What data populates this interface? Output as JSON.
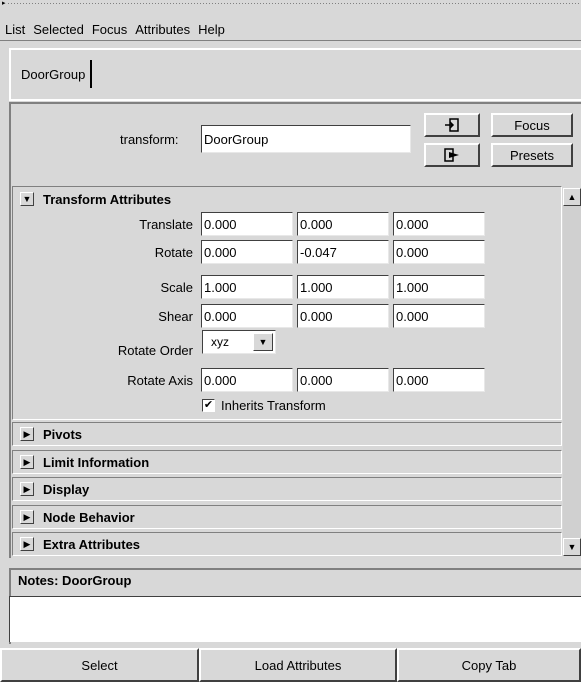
{
  "menubar": {
    "items": [
      "List",
      "Selected",
      "Focus",
      "Attributes",
      "Help"
    ]
  },
  "tabs": [
    {
      "label": "DoorGroup"
    }
  ],
  "node": {
    "label": "transform:",
    "value": "DoorGroup",
    "focus_label": "Focus",
    "presets_label": "Presets",
    "select_icon": "load-selected-icon",
    "output_icon": "output-connections-icon"
  },
  "transform_attributes": {
    "title": "Transform Attributes",
    "rows": [
      {
        "label": "Translate",
        "values": [
          "0.000",
          "0.000",
          "0.000"
        ]
      },
      {
        "label": "Rotate",
        "values": [
          "0.000",
          "-0.047",
          "0.000"
        ]
      },
      {
        "label": "Scale",
        "values": [
          "1.000",
          "1.000",
          "1.000"
        ]
      },
      {
        "label": "Shear",
        "values": [
          "0.000",
          "0.000",
          "0.000"
        ]
      }
    ],
    "rotate_order": {
      "label": "Rotate Order",
      "value": "xyz"
    },
    "rotate_axis": {
      "label": "Rotate Axis",
      "values": [
        "0.000",
        "0.000",
        "0.000"
      ]
    },
    "inherits": {
      "label": "Inherits Transform",
      "checked": true
    }
  },
  "collapsed_sections": [
    {
      "title": "Pivots"
    },
    {
      "title": "Limit Information"
    },
    {
      "title": "Display"
    },
    {
      "title": "Node Behavior"
    },
    {
      "title": "Extra Attributes"
    }
  ],
  "notes": {
    "label": "Notes: DoorGroup",
    "value": ""
  },
  "bottom_buttons": [
    {
      "label": "Select"
    },
    {
      "label": "Load Attributes"
    },
    {
      "label": "Copy Tab"
    }
  ]
}
